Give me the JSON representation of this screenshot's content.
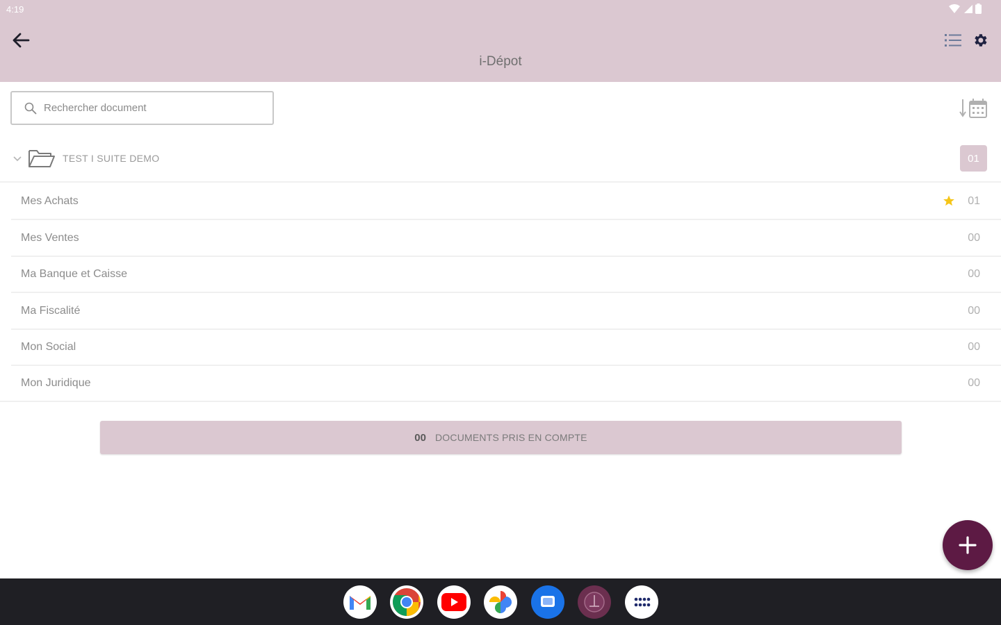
{
  "status_bar": {
    "time": "4:19",
    "icons": [
      "wifi-icon",
      "signal-icon",
      "battery-icon"
    ]
  },
  "app_bar": {
    "title": "i-Dépot",
    "back_icon": "arrow-left-icon",
    "actions": [
      "list-view-icon",
      "gear-icon"
    ]
  },
  "search": {
    "placeholder": "Rechercher document",
    "value": ""
  },
  "sort_icon": "sort-by-date-icon",
  "folder": {
    "name": "TEST I SUITE DEMO",
    "count": "01",
    "expanded": true
  },
  "categories": [
    {
      "label": "Mes Achats",
      "count": "01",
      "starred": true
    },
    {
      "label": "Mes Ventes",
      "count": "00",
      "starred": false
    },
    {
      "label": "Ma Banque et Caisse",
      "count": "00",
      "starred": false
    },
    {
      "label": "Ma Fiscalité",
      "count": "00",
      "starred": false
    },
    {
      "label": "Mon Social",
      "count": "00",
      "starred": false
    },
    {
      "label": "Mon Juridique",
      "count": "00",
      "starred": false
    }
  ],
  "summary": {
    "count": "00",
    "label": "DOCUMENTS PRIS EN COMPTE"
  },
  "fab_icon": "plus-icon",
  "colors": {
    "header_bg": "#dbc8d1",
    "accent": "#5d1a44",
    "star": "#f5c518",
    "dock_bg": "#1f1f24"
  },
  "dock_apps": [
    "gmail-icon",
    "chrome-icon",
    "youtube-icon",
    "photos-icon",
    "messages-icon",
    "idepot-app-icon",
    "app-drawer-icon"
  ]
}
